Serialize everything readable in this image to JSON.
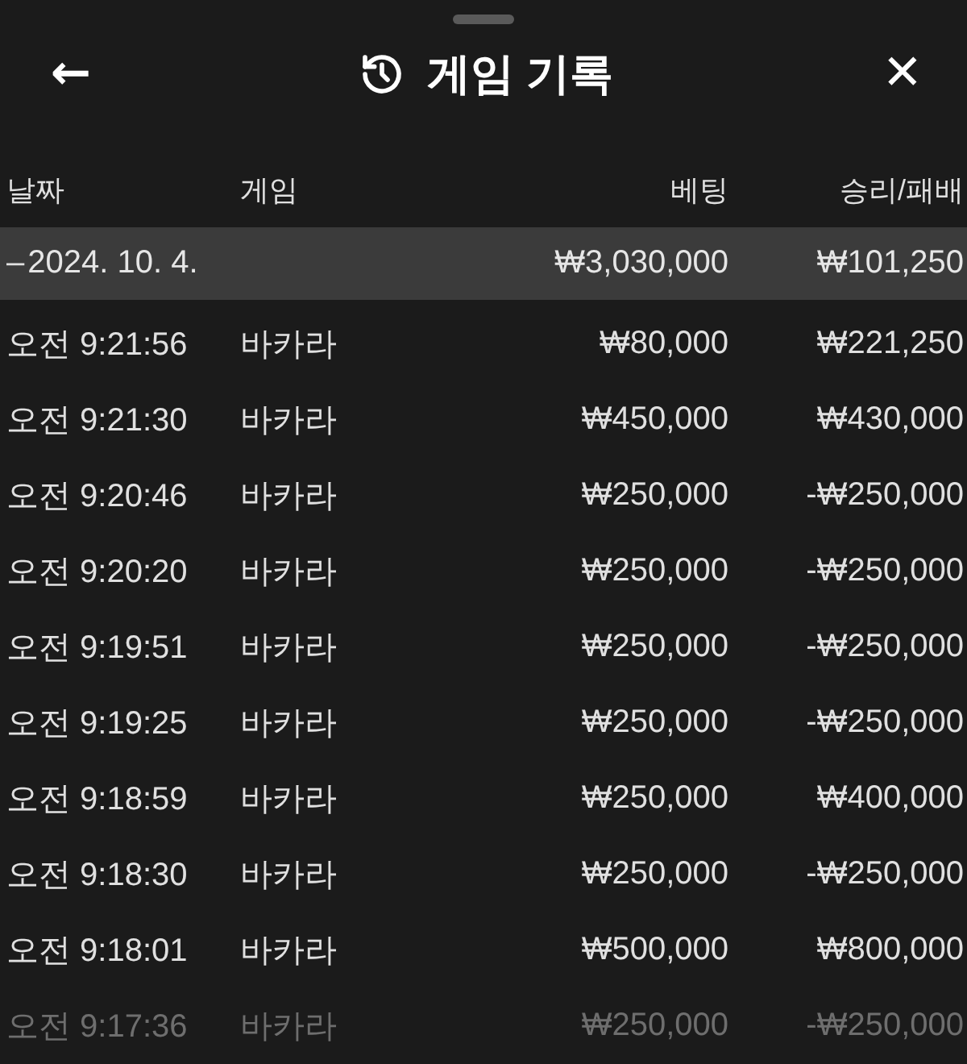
{
  "header": {
    "back": "←",
    "title": "게임 기록",
    "close": "✕"
  },
  "columns": [
    "날짜",
    "게임",
    "베팅",
    "승리/패배"
  ],
  "group": {
    "toggle": "–",
    "date": "2024. 10. 4.",
    "bet": "₩3,030,000",
    "result": "₩101,250"
  },
  "rows": [
    {
      "time": "오전 9:21:56",
      "game": "바카라",
      "bet": "₩80,000",
      "result": "₩221,250",
      "faded": false
    },
    {
      "time": "오전 9:21:30",
      "game": "바카라",
      "bet": "₩450,000",
      "result": "₩430,000",
      "faded": false
    },
    {
      "time": "오전 9:20:46",
      "game": "바카라",
      "bet": "₩250,000",
      "result": "-₩250,000",
      "faded": false
    },
    {
      "time": "오전 9:20:20",
      "game": "바카라",
      "bet": "₩250,000",
      "result": "-₩250,000",
      "faded": false
    },
    {
      "time": "오전 9:19:51",
      "game": "바카라",
      "bet": "₩250,000",
      "result": "-₩250,000",
      "faded": false
    },
    {
      "time": "오전 9:19:25",
      "game": "바카라",
      "bet": "₩250,000",
      "result": "-₩250,000",
      "faded": false
    },
    {
      "time": "오전 9:18:59",
      "game": "바카라",
      "bet": "₩250,000",
      "result": "₩400,000",
      "faded": false
    },
    {
      "time": "오전 9:18:30",
      "game": "바카라",
      "bet": "₩250,000",
      "result": "-₩250,000",
      "faded": false
    },
    {
      "time": "오전 9:18:01",
      "game": "바카라",
      "bet": "₩500,000",
      "result": "₩800,000",
      "faded": false
    },
    {
      "time": "오전 9:17:36",
      "game": "바카라",
      "bet": "₩250,000",
      "result": "-₩250,000",
      "faded": true
    }
  ]
}
